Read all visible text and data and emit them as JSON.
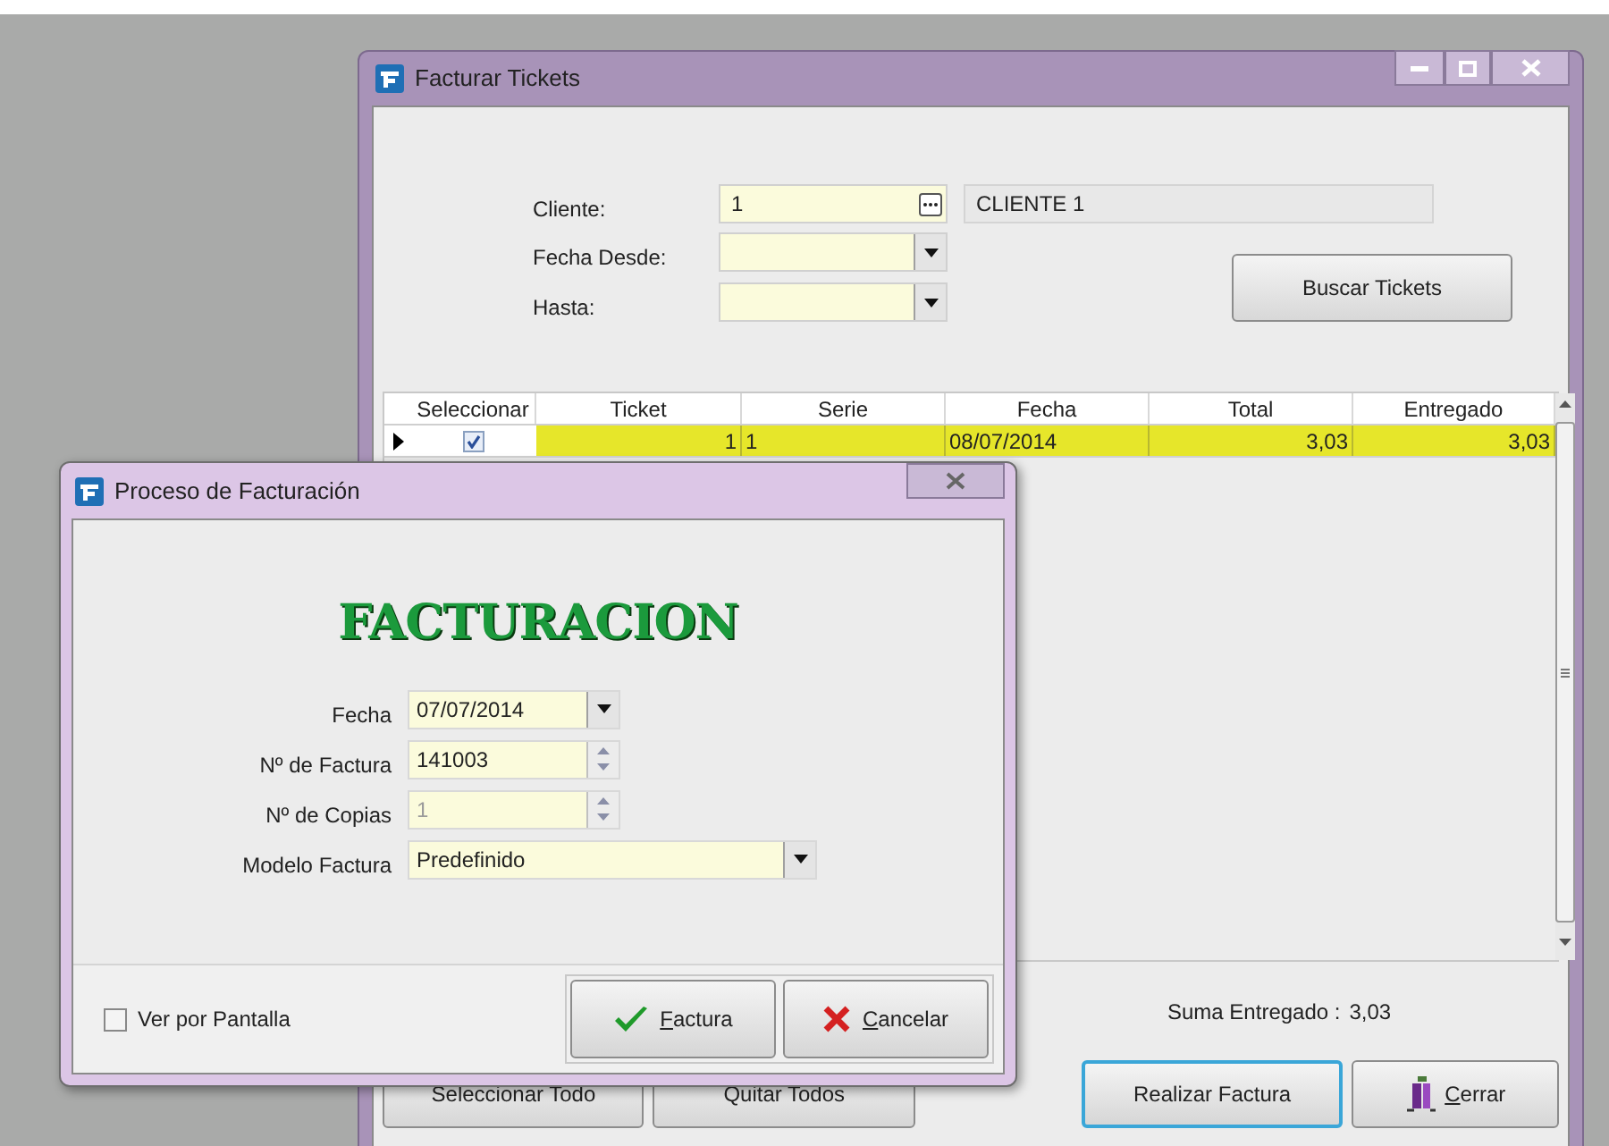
{
  "main_window": {
    "title": "Facturar Tickets",
    "cliente": {
      "label": "Cliente:",
      "value": "1",
      "name": "CLIENTE 1"
    },
    "fecha_desde": {
      "label": "Fecha Desde:"
    },
    "hasta": {
      "label": "Hasta:"
    },
    "search_button": "Buscar Tickets",
    "table": {
      "columns": [
        "Seleccionar",
        "Ticket",
        "Serie",
        "Fecha",
        "Total",
        "Entregado"
      ],
      "rows": [
        {
          "selected": true,
          "checked": true,
          "ticket": "1",
          "serie": "1",
          "fecha": "08/07/2014",
          "total": "3,03",
          "entregado": "3,03"
        }
      ]
    },
    "sum_label": "Suma Entregado :",
    "sum_value": "3,03",
    "buttons": [
      {
        "label": "Seleccionar Todo",
        "kind": "plain",
        "focused": false
      },
      {
        "label": "Quitar Todos",
        "kind": "plain",
        "focused": false
      },
      {
        "label": "Realizar Factura",
        "kind": "plain",
        "focused": true
      },
      {
        "label": "Cerrar",
        "kind": "exit",
        "focused": false
      }
    ]
  },
  "dialog": {
    "title": "Proceso de Facturación",
    "heading": "FACTURACION",
    "fields": [
      {
        "label": "Fecha",
        "value": "07/07/2014",
        "kind": "date",
        "disabled": false
      },
      {
        "label": "Nº de  Factura",
        "value": "141003",
        "kind": "spin",
        "disabled": false
      },
      {
        "label": "Nº de Copias",
        "value": "1",
        "kind": "spin",
        "disabled": true
      },
      {
        "label": "Modelo Factura",
        "value": "Predefinido",
        "kind": "combo",
        "disabled": false
      }
    ],
    "checkbox": {
      "label": "Ver por Pantalla",
      "checked": false
    },
    "buttons": [
      {
        "label": "Factura",
        "kind": "ok"
      },
      {
        "label": "Cancelar",
        "kind": "cancel"
      }
    ]
  }
}
